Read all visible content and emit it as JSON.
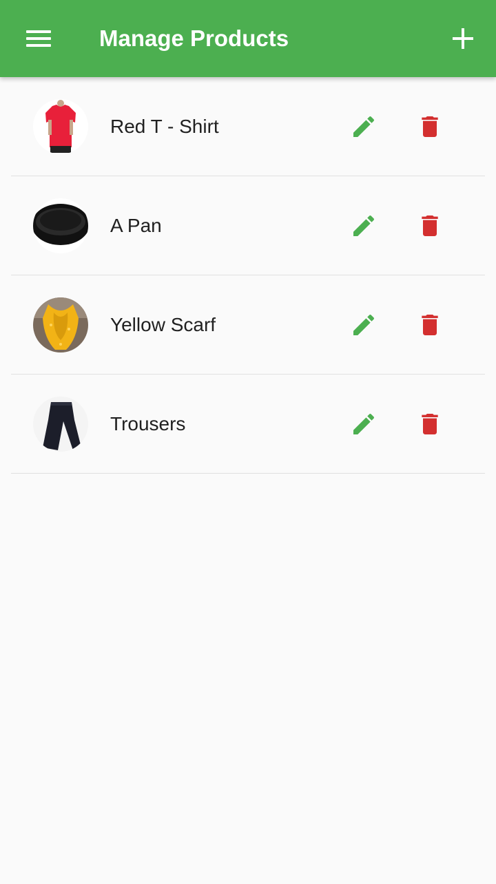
{
  "colors": {
    "primary": "#4caf50",
    "edit": "#4caf50",
    "delete": "#d32f2f",
    "text": "#212121",
    "background": "#fafafa"
  },
  "appbar": {
    "title": "Manage Products",
    "leading_icon": "menu-icon",
    "action_icon": "add-icon"
  },
  "products": [
    {
      "title": "Red T - Shirt",
      "image": "red-tshirt",
      "edit_icon": "edit-icon",
      "delete_icon": "delete-icon"
    },
    {
      "title": "A Pan",
      "image": "black-pan",
      "edit_icon": "edit-icon",
      "delete_icon": "delete-icon"
    },
    {
      "title": "Yellow Scarf",
      "image": "yellow-scarf",
      "edit_icon": "edit-icon",
      "delete_icon": "delete-icon"
    },
    {
      "title": "Trousers",
      "image": "black-trousers",
      "edit_icon": "edit-icon",
      "delete_icon": "delete-icon"
    }
  ]
}
